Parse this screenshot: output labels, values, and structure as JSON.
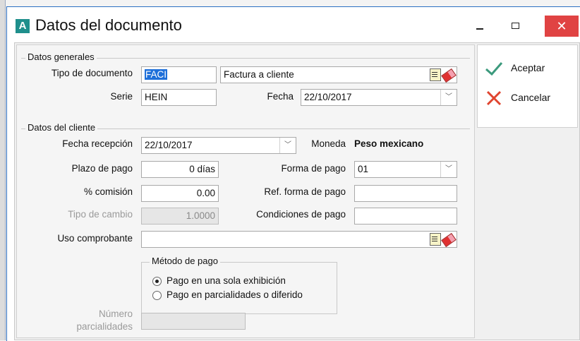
{
  "window": {
    "title": "Datos del documento",
    "app_icon": "A"
  },
  "datos_generales": {
    "legend": "Datos generales",
    "tipo_documento": {
      "label": "Tipo de documento",
      "code": "FACI",
      "description": "Factura a cliente"
    },
    "serie": {
      "label": "Serie",
      "value": "HEIN"
    },
    "fecha": {
      "label": "Fecha",
      "value": "22/10/2017"
    }
  },
  "datos_cliente": {
    "legend": "Datos del cliente",
    "fecha_recepcion": {
      "label": "Fecha recepción",
      "value": "22/10/2017"
    },
    "moneda": {
      "label": "Moneda",
      "value": "Peso mexicano"
    },
    "plazo_pago": {
      "label": "Plazo de pago",
      "value": "0 días"
    },
    "forma_pago": {
      "label": "Forma de pago",
      "value": "01"
    },
    "comision": {
      "label": "% comisión",
      "value": "0.00"
    },
    "ref_forma_pago": {
      "label": "Ref. forma de pago",
      "value": ""
    },
    "tipo_cambio": {
      "label": "Tipo de cambio",
      "value": "1.0000"
    },
    "condiciones_pago": {
      "label": "Condiciones de pago",
      "value": ""
    },
    "uso_comprobante": {
      "label": "Uso comprobante",
      "value": ""
    },
    "metodo_pago": {
      "legend": "Método de pago",
      "options": [
        "Pago en una sola exhibición",
        "Pago en parcialidades o diferido"
      ],
      "selected": 0
    },
    "numero_parcialidades": {
      "label_line1": "Número",
      "label_line2": "parcialidades",
      "value": ""
    }
  },
  "actions": {
    "accept": "Aceptar",
    "cancel": "Cancelar"
  },
  "colors": {
    "accept": "#3c9a7d",
    "cancel": "#e0442f",
    "close": "#e04343",
    "selection": "#1e6fd9"
  }
}
